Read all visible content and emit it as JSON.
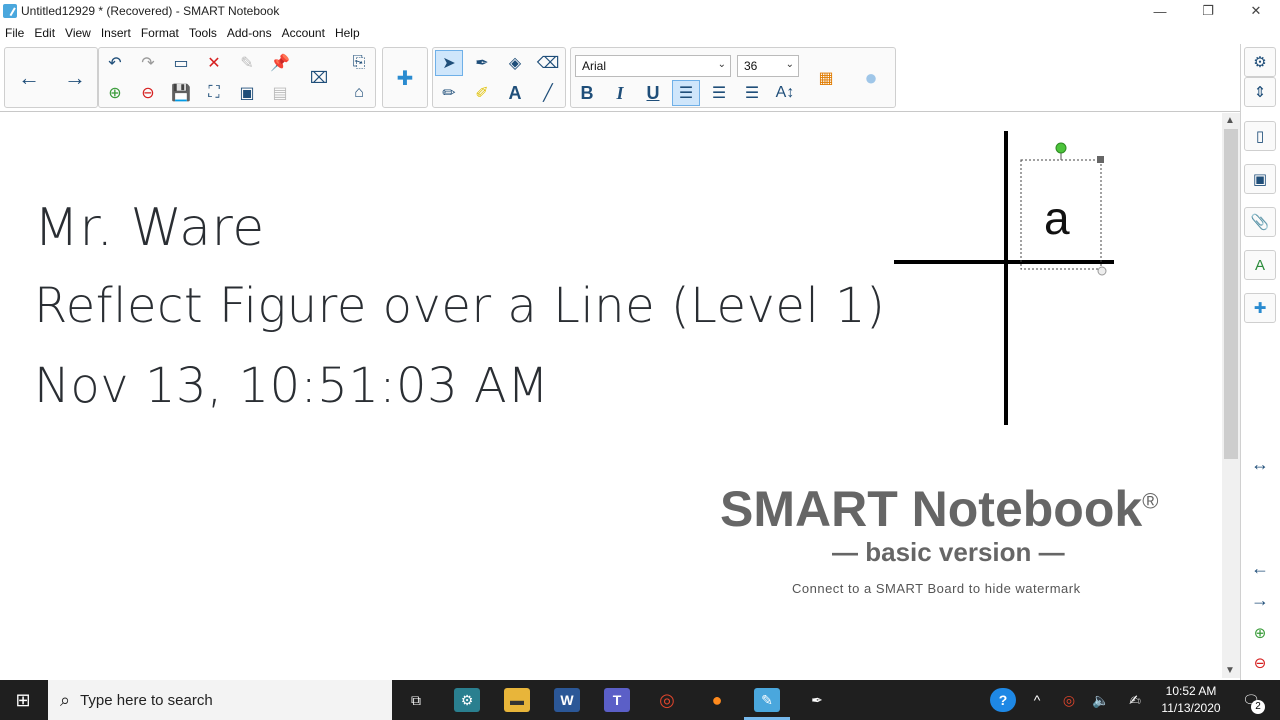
{
  "window": {
    "title": "Untitled12929 * (Recovered) - SMART Notebook",
    "minimize": "—",
    "restore": "❐",
    "close": "✕"
  },
  "menu": [
    "File",
    "Edit",
    "View",
    "Insert",
    "Format",
    "Tools",
    "Add-ons",
    "Account",
    "Help"
  ],
  "toolbar": {
    "font_name": "Arial",
    "font_size": "36",
    "bold": "B",
    "italic": "I",
    "underline": "U",
    "text_tool": "A"
  },
  "page": {
    "line1": "Mr. Ware",
    "line2": "Reflect Figure over a Line (Level 1)",
    "line3": "Nov 13, 10:51:03 AM",
    "figure_letter": "a"
  },
  "watermark": {
    "title": "SMART Notebook",
    "reg": "®",
    "subtitle": "— basic version —",
    "note": "Connect to a SMART Board to hide watermark"
  },
  "taskbar": {
    "search_placeholder": "Type here to search",
    "time": "10:52 AM",
    "date": "11/13/2020",
    "notification_count": "2"
  },
  "colors": {
    "accent": "#1f4e79",
    "handle_green": "#4cc33b",
    "watermark_gray": "#666666"
  }
}
